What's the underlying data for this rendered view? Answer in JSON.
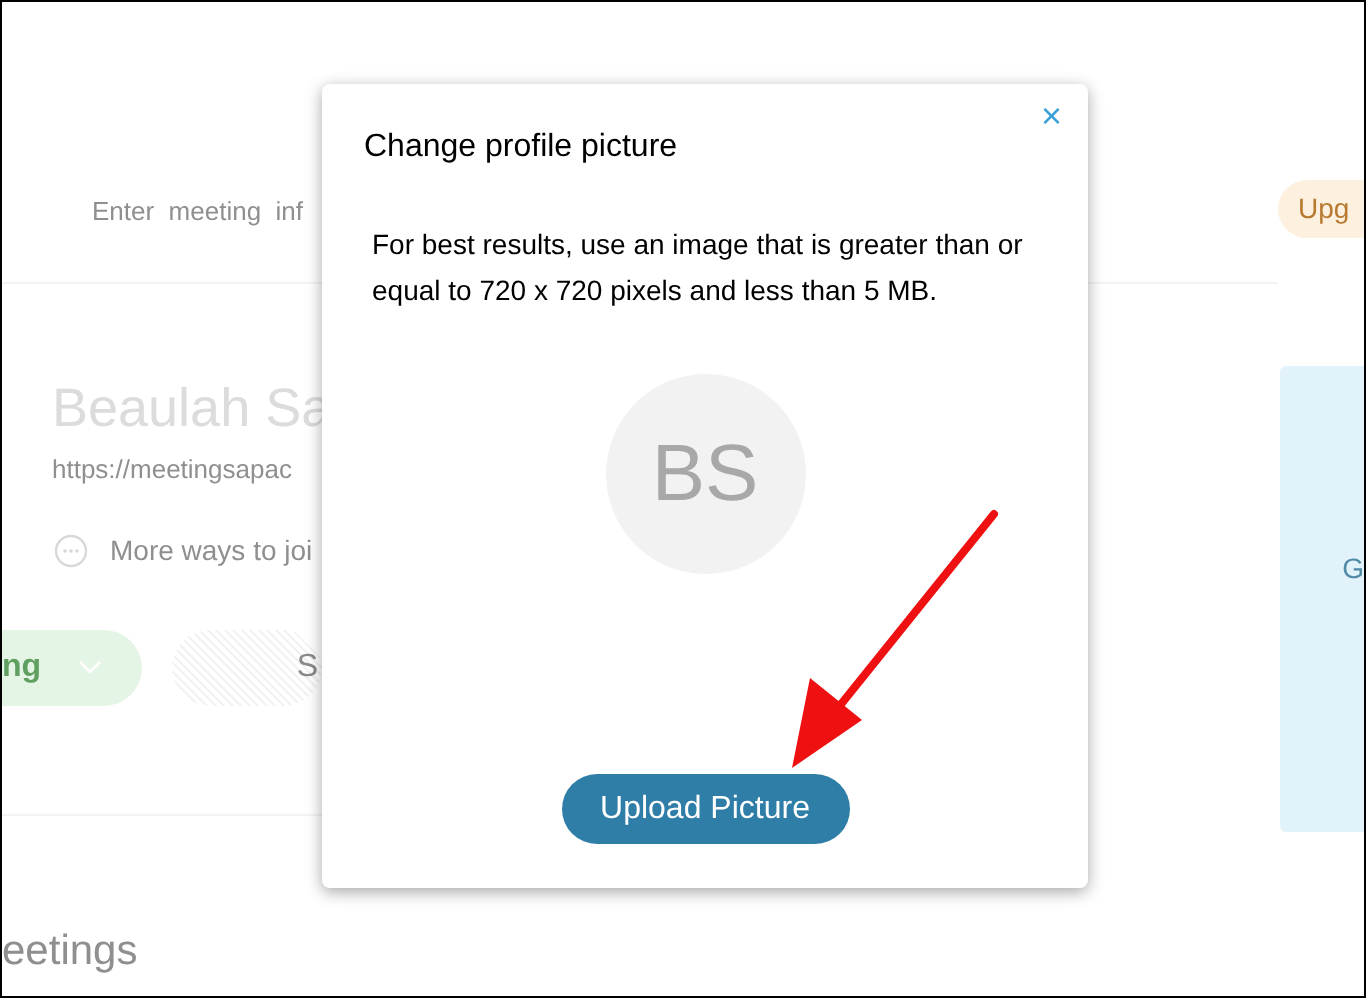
{
  "background": {
    "search_placeholder": "Enter  meeting  inf",
    "name": "Beaulah Sa",
    "link": "https://meetingsapac",
    "more_ways": "More ways to joi",
    "start_button": "ng",
    "second_button": "S",
    "section_title": "eetings",
    "upgrade_button": "Upg",
    "card_text": "G"
  },
  "dialog": {
    "title": "Change profile picture",
    "close": "×",
    "message": "For best results, use an image that is greater than or equal to 720 x 720 pixels and less than 5 MB.",
    "avatar_initials": "BS",
    "upload_button": "Upload Picture"
  }
}
